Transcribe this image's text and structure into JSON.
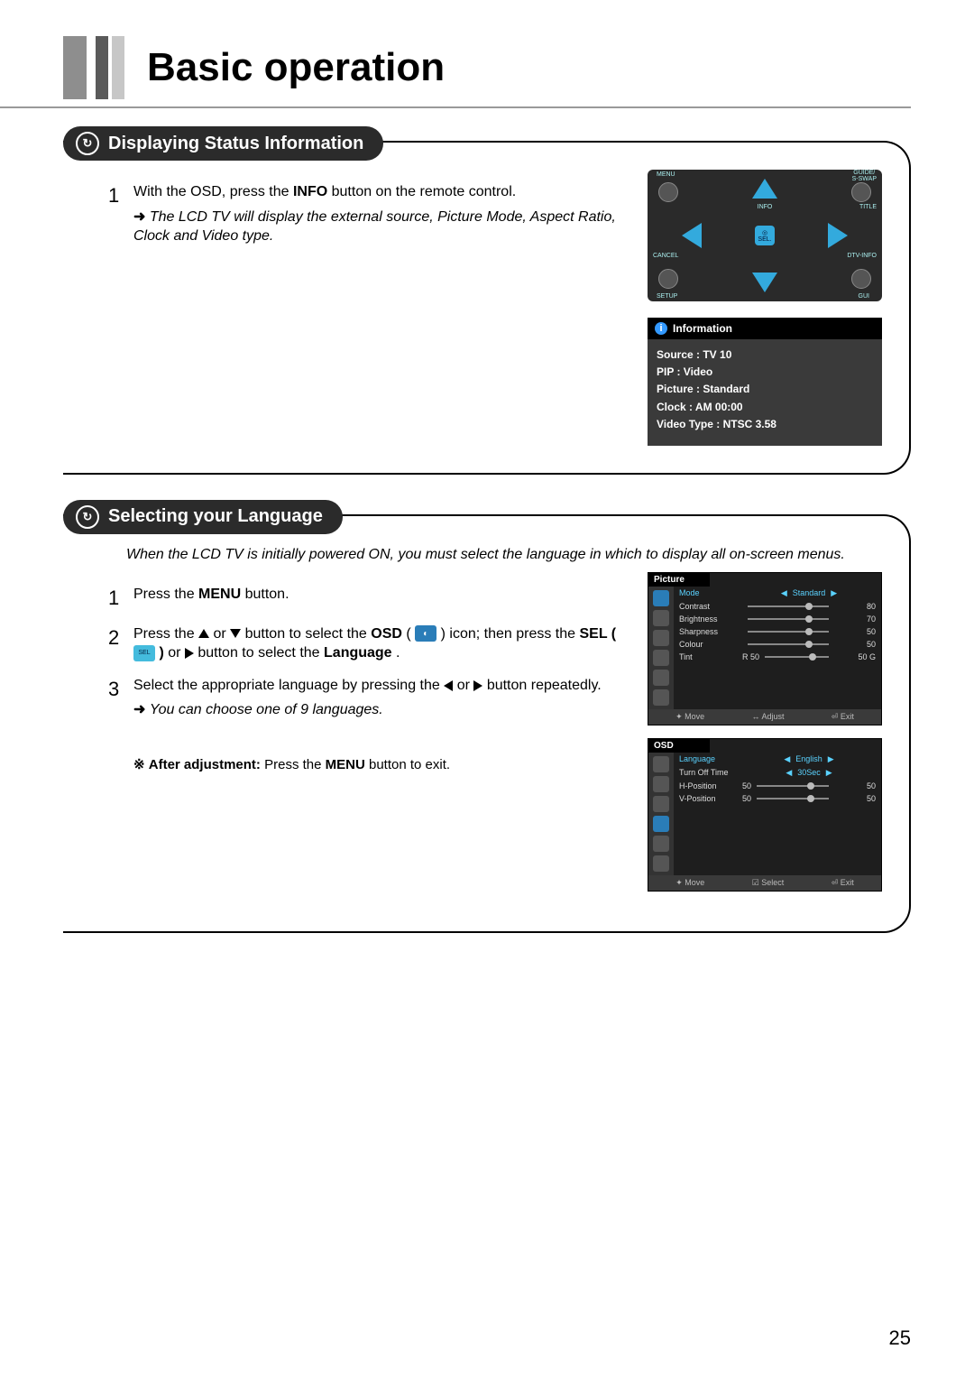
{
  "header": {
    "title": "Basic operation"
  },
  "page_number": "25",
  "section1": {
    "heading": "Displaying Status Information",
    "step1_a": "With the OSD, press the ",
    "step1_b": "INFO",
    "step1_c": " button on the remote control.",
    "step1_note": "The LCD TV will display the external source, Picture Mode, Aspect Ratio, Clock and Video type.",
    "remote_labels": {
      "menu": "MENU",
      "guide": "GUIDE/\nS-SWAP",
      "info": "INFO",
      "title": "TITLE",
      "sel": "SEL.",
      "cancel": "CANCEL",
      "dtv": "DTV-INFO",
      "setup": "SETUP",
      "gui": "GUI"
    },
    "info_panel": {
      "title": "Information",
      "lines": [
        "Source : TV 10",
        "PIP : Video",
        "Picture : Standard",
        "Clock : AM 00:00",
        "Video Type : NTSC 3.58"
      ]
    }
  },
  "section2": {
    "heading": "Selecting your Language",
    "intro": "When the LCD TV is initially powered ON, you must select the language in which to display all on-screen menus.",
    "step1_a": "Press the ",
    "step1_b": "MENU",
    "step1_c": " button.",
    "step2_a": "Press the ",
    "step2_b": " or ",
    "step2_c": " button to select the ",
    "step2_d": "OSD",
    "step2_e": " ( ",
    "step2_f": " ) icon;  then press the ",
    "step2_g": "SEL ( ",
    "step2_h": " )",
    "step2_i": " or ",
    "step2_j": " button to select the ",
    "step2_k": "Language",
    "step2_l": ".",
    "step3_a": "Select the appropriate language by pressing the ",
    "step3_b": " or ",
    "step3_c": " button repeatedly.",
    "step3_note": "You can choose one of 9 languages.",
    "after_a": "After adjustment:",
    "after_b": " Press the ",
    "after_c": "MENU",
    "after_d": " button to exit.",
    "osd_picture": {
      "title": "Picture",
      "rows": [
        {
          "name": "Mode",
          "center": "Standard",
          "hi": true
        },
        {
          "name": "Contrast",
          "val": "80"
        },
        {
          "name": "Brightness",
          "val": "70"
        },
        {
          "name": "Sharpness",
          "val": "50"
        },
        {
          "name": "Colour",
          "val": "50"
        },
        {
          "name": "Tint",
          "pre": "R  50",
          "val": "50  G"
        }
      ],
      "foot": [
        "✦ Move",
        "↔ Adjust",
        "⏎ Exit"
      ]
    },
    "osd_osd": {
      "title": "OSD",
      "rows": [
        {
          "name": "Language",
          "center": "English",
          "hi": true
        },
        {
          "name": "Turn Off Time",
          "center": "30Sec"
        },
        {
          "name": "H-Position",
          "pre": "50",
          "val": "50"
        },
        {
          "name": "V-Position",
          "pre": "50",
          "val": "50"
        }
      ],
      "foot": [
        "✦ Move",
        "☑ Select",
        "⏎ Exit"
      ]
    }
  }
}
